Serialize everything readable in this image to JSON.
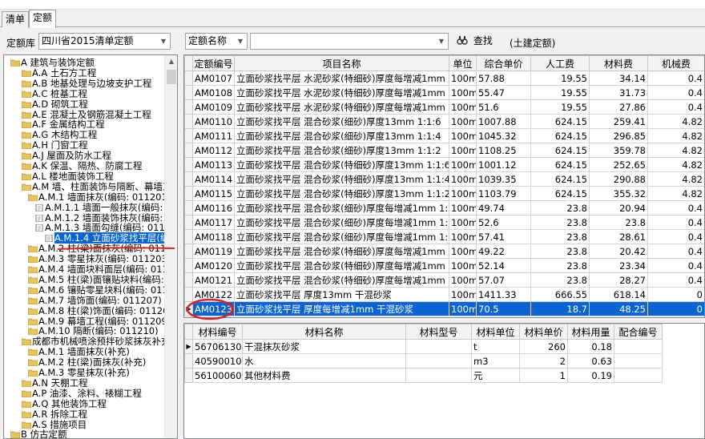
{
  "tabs": [
    {
      "label": "清单"
    },
    {
      "label": "定额"
    }
  ],
  "toolbar": {
    "library_label": "定额库",
    "library_value": "四川省2015清单定额",
    "field_value": "定额名称",
    "search_value": "",
    "search_label": "查找",
    "mode_label": "(土建定额)"
  },
  "tree": {
    "nodes": [
      {
        "label": "A 建筑与装饰定额"
      },
      {
        "label": "A.A 土石方工程"
      },
      {
        "label": "A.B 地基处理与边坡支护工程"
      },
      {
        "label": "A.C 桩基工程"
      },
      {
        "label": "A.D 砌筑工程"
      },
      {
        "label": "A.E 混凝土及钢筋混凝土工程"
      },
      {
        "label": "A.F 金属结构工程"
      },
      {
        "label": "A.G 木结构工程"
      },
      {
        "label": "A.H 门窗工程"
      },
      {
        "label": "A.J 屋面及防水工程"
      },
      {
        "label": "A.K 保温、隔热、防腐工程"
      },
      {
        "label": "A.L 楼地面装饰工程"
      },
      {
        "label": "A.M 墙、柱面装饰与隔断、幕墙工程"
      },
      {
        "label": "A.M.1 墙面抹灰(编码: 011201)"
      },
      {
        "label": "A.M.1.1 墙面一般抹灰(编码: 011201001)"
      },
      {
        "label": "A.M.1.2 墙面装饰抹灰(编码: 011201002)"
      },
      {
        "label": "A.M.1.3 墙面勾缝(编码: 011201003)"
      },
      {
        "label": "A.M.1.4 立面砂浆找平层(编码: 011201004)"
      },
      {
        "label": "A.M.2 柱(梁)面抹灰(编码: 011202)"
      },
      {
        "label": "A.M.3 零星抹灰(编码: 011203)"
      },
      {
        "label": "A.M.4 墙面块料面层(编码: 011204)"
      },
      {
        "label": "A.M.5 柱(梁)面镶贴块料(编码: 011205)"
      },
      {
        "label": "A.M.6 镶贴零星块料(编码: 011206)"
      },
      {
        "label": "A.M.7 墙饰面(编码: 011207)"
      },
      {
        "label": "A.M.8 柱(梁)饰面(编码: 011208)"
      },
      {
        "label": "A.M.9 幕墙工程(编码: 011209)"
      },
      {
        "label": "A.M.10 隔断(编码: 011210)"
      },
      {
        "label": "成都市机械喷涂预拌砂浆抹灰补充定额"
      },
      {
        "label": "A.M.1 墙面抹灰(补充)"
      },
      {
        "label": "A.M.2 柱(梁)面抹灰(补充)"
      },
      {
        "label": "A.M.3 零星抹灰(补充)"
      },
      {
        "label": "A.N 天棚工程"
      },
      {
        "label": "A.P 油漆、涂料、裱糊工程"
      },
      {
        "label": "A.Q 其他装饰工程"
      },
      {
        "label": "A.R 拆除工程"
      },
      {
        "label": "A.S 措施项目"
      },
      {
        "label": "B 仿古定额"
      }
    ]
  },
  "grid": {
    "columns": [
      "定额编号",
      "项目名称",
      "单位",
      "综合单价",
      "人工费",
      "材料费",
      "机械费"
    ],
    "rows": [
      [
        "AM0107",
        "立面砂浆找平层 水泥砂浆(特细砂)厚度每增减1mm",
        "100m2",
        "57.88",
        "19.55",
        "34.14",
        "0.4"
      ],
      [
        "AM0108",
        "立面砂浆找平层 水泥砂浆(特细砂)厚度每增减1mm",
        "100m2",
        "55.47",
        "19.55",
        "31.73",
        "0.4"
      ],
      [
        "AM0109",
        "立面砂浆找平层 水泥砂浆(特细砂)厚度每增减1mm",
        "100m2",
        "51.6",
        "19.55",
        "27.86",
        "0.4"
      ],
      [
        "AM0110",
        "立面砂浆找平层 混合砂浆(细砂)厚度13mm 1:1:6",
        "100m2",
        "1007.88",
        "624.15",
        "259.41",
        "4.82"
      ],
      [
        "AM0111",
        "立面砂浆找平层 混合砂浆(细砂)厚度13mm 1:1:4",
        "100m2",
        "1045.32",
        "624.15",
        "296.85",
        "4.82"
      ],
      [
        "AM0112",
        "立面砂浆找平层 混合砂浆(细砂)厚度13mm 1:1:2",
        "100m2",
        "1108.25",
        "624.15",
        "359.78",
        "4.82"
      ],
      [
        "AM0113",
        "立面砂浆找平层 混合砂浆(特细砂)厚度13mm 1:1:6",
        "100m2",
        "1001.12",
        "624.15",
        "252.65",
        "4.82"
      ],
      [
        "AM0114",
        "立面砂浆找平层 混合砂浆(特细砂)厚度13mm 1:1:4",
        "100m2",
        "1039.35",
        "624.15",
        "290.88",
        "4.82"
      ],
      [
        "AM0115",
        "立面砂浆找平层 混合砂浆(特细砂)厚度13mm 1:1:2",
        "100m2",
        "1103.79",
        "624.15",
        "355.32",
        "4.82"
      ],
      [
        "AM0116",
        "立面砂浆找平层 混合砂浆(细砂)厚度每增减1mm 1:1:6",
        "100m2",
        "49.74",
        "23.8",
        "20.94",
        "0.4"
      ],
      [
        "AM0117",
        "立面砂浆找平层 混合砂浆(细砂)厚度每增减1mm 1:1:4",
        "100m2",
        "52.6",
        "23.8",
        "23.8",
        "0.4"
      ],
      [
        "AM0118",
        "立面砂浆找平层 混合砂浆(细砂)厚度每增减1mm 1:1:2",
        "100m2",
        "57.41",
        "23.8",
        "28.61",
        "0.4"
      ],
      [
        "AM0119",
        "立面砂浆找平层 混合砂浆(特细砂)厚度每增减1mm",
        "100m2",
        "49.22",
        "23.8",
        "20.42",
        "0.4"
      ],
      [
        "AM0120",
        "立面砂浆找平层 混合砂浆(特细砂)厚度每增减1mm",
        "100m2",
        "52.14",
        "23.8",
        "23.34",
        "0.4"
      ],
      [
        "AM0121",
        "立面砂浆找平层 混合砂浆(特细砂)厚度每增减1mm",
        "100m2",
        "57.07",
        "23.8",
        "28.27",
        "0.4"
      ],
      [
        "AM0122",
        "立面砂浆找平层 厚度13mm 干混砂浆",
        "100m2",
        "1411.33",
        "666.55",
        "618.14",
        "0"
      ],
      [
        "AM0123",
        "立面砂浆找平层 厚度每增减1mm 干混砂浆",
        "100m2",
        "70.5",
        "18.7",
        "48.25",
        "0"
      ]
    ]
  },
  "materials": {
    "columns": [
      "材料编号",
      "材料名称",
      "材料型号",
      "材料单位",
      "材料单价",
      "材料用量",
      "配合编号"
    ],
    "rows": [
      [
        "56706130",
        "干混抹灰砂浆",
        "",
        "t",
        "260",
        "0.18",
        ""
      ],
      [
        "40590010",
        "水",
        "",
        "m3",
        "2",
        "0.63",
        ""
      ],
      [
        "56100060",
        "其他材料费",
        "",
        "元",
        "1",
        "0.19",
        ""
      ]
    ]
  },
  "colors": {
    "selection": "#0a64d2",
    "annotation": "#e02020",
    "folder": "#e8c45a"
  }
}
